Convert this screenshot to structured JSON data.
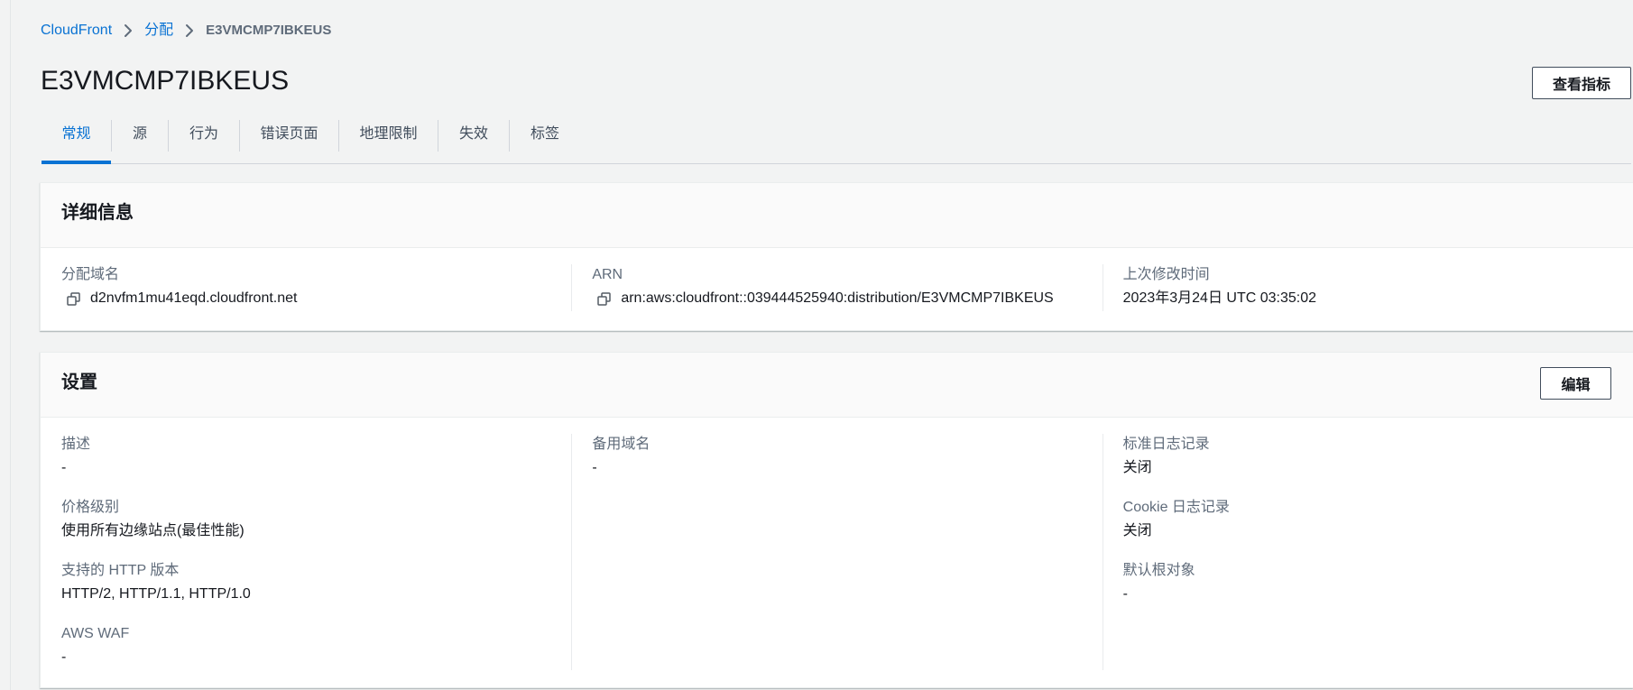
{
  "breadcrumb": {
    "items": [
      {
        "label": "CloudFront",
        "link": true
      },
      {
        "label": "分配",
        "link": true
      },
      {
        "label": "E3VMCMP7IBKEUS",
        "link": false
      }
    ],
    "separator_icon": "chevron-right-icon"
  },
  "header": {
    "title": "E3VMCMP7IBKEUS",
    "view_metrics_label": "查看指标"
  },
  "tabs": [
    {
      "label": "常规",
      "active": true
    },
    {
      "label": "源",
      "active": false
    },
    {
      "label": "行为",
      "active": false
    },
    {
      "label": "错误页面",
      "active": false
    },
    {
      "label": "地理限制",
      "active": false
    },
    {
      "label": "失效",
      "active": false
    },
    {
      "label": "标签",
      "active": false
    }
  ],
  "details": {
    "title": "详细信息",
    "fields": [
      {
        "label": "分配域名",
        "value": "d2nvfm1mu41eqd.cloudfront.net",
        "icon": "copy-icon"
      },
      {
        "label": "ARN",
        "value": "arn:aws:cloudfront::039444525940:distribution/E3VMCMP7IBKEUS",
        "icon": "copy-icon"
      },
      {
        "label": "上次修改时间",
        "value": "2023年3月24日 UTC 03:35:02"
      }
    ]
  },
  "settings": {
    "title": "设置",
    "edit_label": "编辑",
    "columns": [
      [
        {
          "label": "描述",
          "value": "-"
        },
        {
          "label": "价格级别",
          "value": "使用所有边缘站点(最佳性能)"
        },
        {
          "label": "支持的 HTTP 版本",
          "value": "HTTP/2, HTTP/1.1, HTTP/1.0"
        },
        {
          "label": "AWS WAF",
          "value": "-"
        }
      ],
      [
        {
          "label": "备用域名",
          "value": "-"
        }
      ],
      [
        {
          "label": "标准日志记录",
          "value": "关闭"
        },
        {
          "label": "Cookie 日志记录",
          "value": "关闭"
        },
        {
          "label": "默认根对象",
          "value": "-"
        }
      ]
    ]
  },
  "colors": {
    "accent": "#0972d3",
    "page_background": "#f2f3f3",
    "text": "#16191f",
    "label_text": "#5f6b7a"
  }
}
